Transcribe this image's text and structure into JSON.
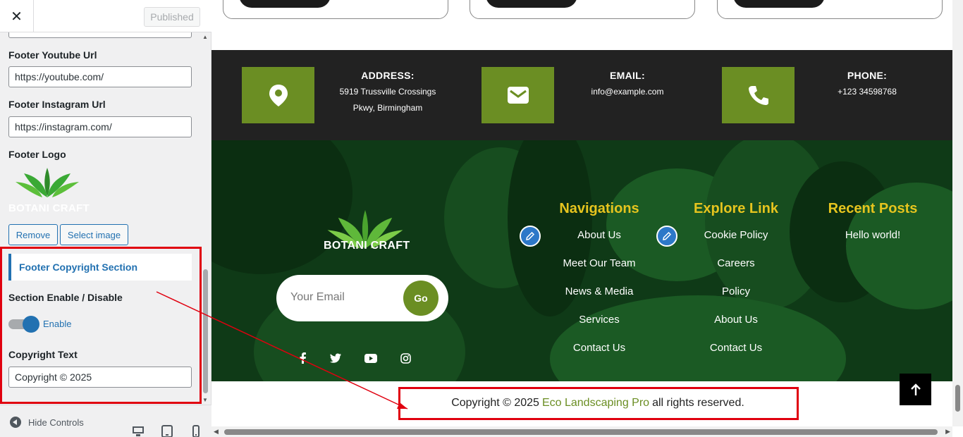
{
  "customizer": {
    "close_icon": "close-icon",
    "close_glyph": "✕",
    "publish_button": "Published",
    "footer_youtube_label": "Footer Youtube Url",
    "footer_youtube_value": "https://youtube.com/",
    "footer_instagram_label": "Footer Instagram Url",
    "footer_instagram_value": "https://instagram.com/",
    "footer_logo_label": "Footer Logo",
    "logo_preview_text": "BOTANI CRAFT",
    "remove_button": "Remove",
    "select_image_button": "Select image",
    "section_title": "Footer Copyright Section",
    "enable_label": "Section Enable / Disable",
    "toggle_label": "Enable",
    "toggle_on": true,
    "copyright_label": "Copyright Text",
    "copyright_value": "Copyright © 2025",
    "hide_controls": "Hide Controls",
    "accent_color": "#2271b1"
  },
  "preview": {
    "contact": [
      {
        "title": "ADDRESS:",
        "lines": [
          "5919 Trussville Crossings",
          "Pkwy, Birmingham"
        ],
        "icon": "location-pin-icon"
      },
      {
        "title": "EMAIL:",
        "lines": [
          "info@example.com"
        ],
        "icon": "envelope-icon"
      },
      {
        "title": "PHONE:",
        "lines": [
          "+123 34598768"
        ],
        "icon": "phone-icon"
      }
    ],
    "brand": "BOTANI CRAFT",
    "email_placeholder": "Your Email",
    "go_button": "Go",
    "social_icons": [
      "facebook-icon",
      "twitter-icon",
      "youtube-icon",
      "instagram-icon"
    ],
    "navigations": {
      "title": "Navigations",
      "links": [
        "About Us",
        "Meet Our Team",
        "News & Media",
        "Services",
        "Contact Us"
      ]
    },
    "explore": {
      "title": "Explore Link",
      "links": [
        "Cookie Policy",
        "Careers",
        "Policy",
        "About Us",
        "Contact Us"
      ]
    },
    "recent": {
      "title": "Recent Posts",
      "links": [
        "Hello world!"
      ]
    },
    "copyright_prefix": "Copyright © 2025",
    "copyright_brand": "Eco Landscaping Pro",
    "copyright_suffix": "all rights reserved.",
    "colors": {
      "green": "#6b8e23",
      "yellow": "#e6c41e",
      "dark": "#222222"
    }
  }
}
